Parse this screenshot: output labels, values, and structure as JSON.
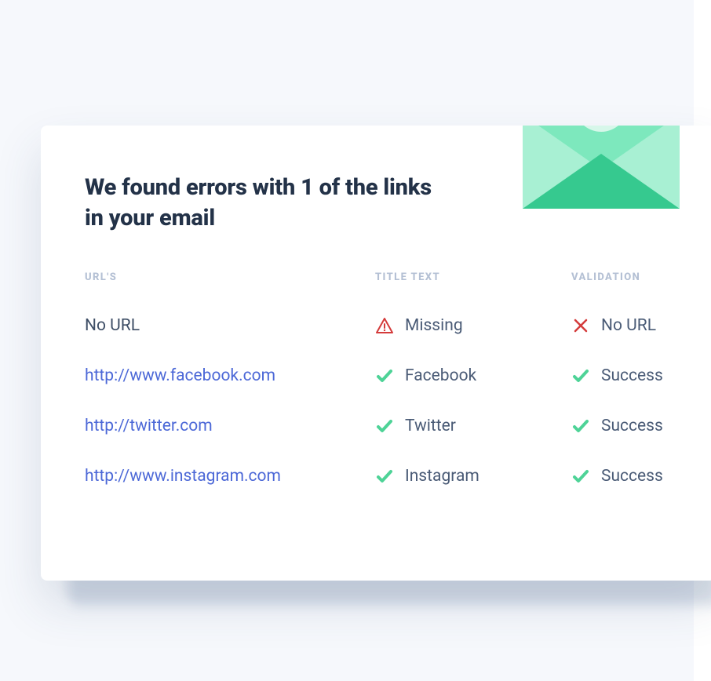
{
  "heading": "We found errors with 1 of the links in your email",
  "columns": {
    "url": "URL'S",
    "title": "TITLE TEXT",
    "validation": "VALIDATION"
  },
  "rows": [
    {
      "url": "No URL",
      "url_is_link": false,
      "title_icon": "warning",
      "title_text": "Missing",
      "validation_icon": "x",
      "validation_text": "No URL"
    },
    {
      "url": "http://www.facebook.com",
      "url_is_link": true,
      "title_icon": "check",
      "title_text": "Facebook",
      "validation_icon": "check",
      "validation_text": "Success"
    },
    {
      "url": "http://twitter.com",
      "url_is_link": true,
      "title_icon": "check",
      "title_text": "Twitter",
      "validation_icon": "check",
      "validation_text": "Success"
    },
    {
      "url": "http://www.instagram.com",
      "url_is_link": true,
      "title_icon": "check",
      "title_text": "Instagram",
      "validation_icon": "check",
      "validation_text": "Success"
    }
  ],
  "colors": {
    "check": "#4ed397",
    "warn": "#d43b3b",
    "x": "#d43b3b"
  }
}
